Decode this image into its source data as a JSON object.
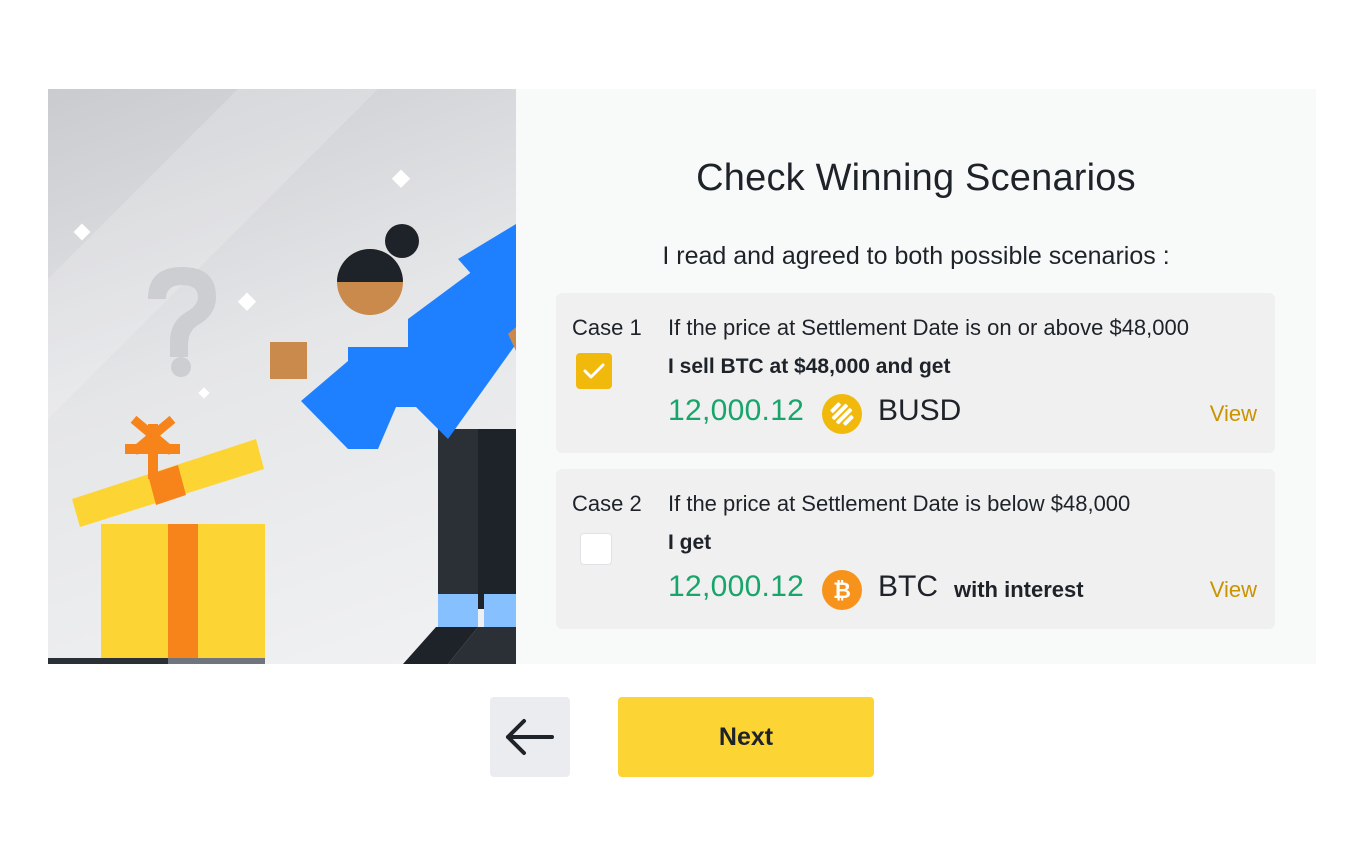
{
  "dialog": {
    "title": "Check Winning Scenarios",
    "subtitle": "I read and agreed to both possible scenarios :"
  },
  "cases": [
    {
      "label": "Case 1",
      "condition": "If the price at Settlement Date is on or above $48,000",
      "action": "I sell BTC at $48,000 and get",
      "amount": "12,000.12",
      "coin_icon": "busd-icon",
      "coin": "BUSD",
      "extra": "",
      "view_label": "View",
      "checked": true
    },
    {
      "label": "Case 2",
      "condition": "If the price at Settlement Date is below $48,000",
      "action": "I get",
      "amount": "12,000.12",
      "coin_icon": "btc-icon",
      "coin": "BTC",
      "extra": "with interest",
      "view_label": "View",
      "checked": false
    }
  ],
  "footer": {
    "back_icon": "arrow-left-icon",
    "next_label": "Next"
  },
  "colors": {
    "accent": "#fcd535",
    "checkbox": "#f0b90b",
    "amount_green": "#17a56b",
    "link_gold": "#c99400",
    "busd": "#f0b90b",
    "btc": "#f7931a"
  }
}
